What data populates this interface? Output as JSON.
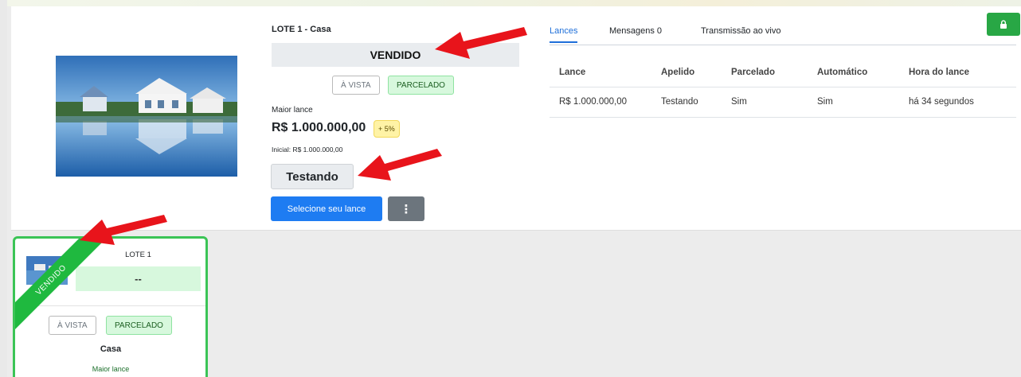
{
  "lot": {
    "title": "LOTE 1 - Casa",
    "status": "VENDIDO",
    "payment_options": {
      "avista": "À VISTA",
      "parcelado": "PARCELADO"
    },
    "max_bid_label": "Maior lance",
    "max_bid_value": "R$ 1.000.000,00",
    "increment_badge": "+ 5%",
    "initial_text": "Inicial: R$ 1.000.000,00",
    "leading_bidder": "Testando",
    "select_bid_label": "Selecione seu lance",
    "more_label": "⋮"
  },
  "tabs": {
    "bids": "Lances",
    "messages": "Mensagens 0",
    "live": "Transmissão ao vivo"
  },
  "table": {
    "headers": [
      "Lance",
      "Apelido",
      "Parcelado",
      "Automático",
      "Hora do lance"
    ],
    "rows": [
      [
        "R$ 1.000.000,00",
        "Testando",
        "Sim",
        "Sim",
        "há 34 segundos"
      ]
    ]
  },
  "card": {
    "lot_label": "LOTE 1",
    "price": "--",
    "ribbon": "VENDIDO",
    "payment_options": {
      "avista": "À VISTA",
      "parcelado": "PARCELADO"
    },
    "name": "Casa",
    "max_bid_label": "Maior lance"
  },
  "colors": {
    "primary": "#1e7cf2",
    "success": "#28a745",
    "sold_ribbon": "#1fb93f",
    "annotation_arrow": "#e8141b"
  },
  "icons": [
    "lock-icon",
    "more-vertical-icon",
    "arrow-annotation-icon"
  ]
}
